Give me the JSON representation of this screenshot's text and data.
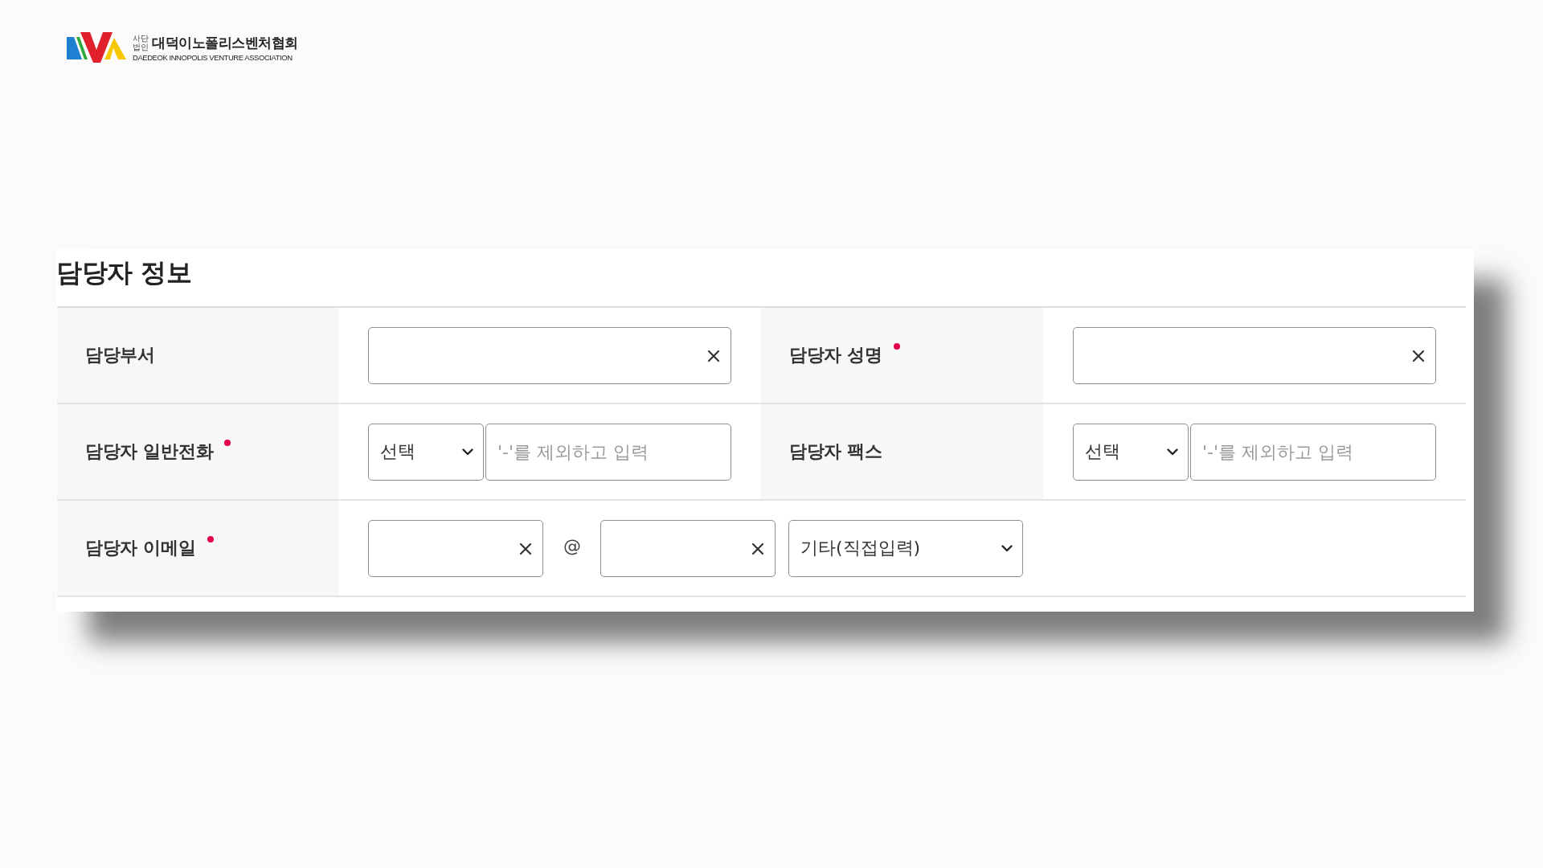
{
  "logo": {
    "prefix_lines": [
      "사단",
      "법인"
    ],
    "name": "대덕이노폴리스벤처협회",
    "english_name": "DAEDEOK INNOPOLIS VENTURE ASSOCIATION"
  },
  "section": {
    "title": "담당자 정보",
    "rows": [
      {
        "cells": [
          {
            "label": "담당부서",
            "required": false,
            "controls": [
              {
                "kind": "input",
                "clear": true
              }
            ]
          },
          {
            "label": "담당자 성명",
            "required": true,
            "controls": [
              {
                "kind": "input",
                "clear": true
              }
            ]
          }
        ]
      },
      {
        "cells": [
          {
            "label": "담당자 일반전화",
            "required": true,
            "controls": [
              {
                "kind": "select",
                "value": "선택"
              },
              {
                "kind": "input",
                "clear": false,
                "placeholder": "'-'를 제외하고 입력"
              }
            ]
          },
          {
            "label": "담당자 팩스",
            "required": false,
            "controls": [
              {
                "kind": "select",
                "value": "선택"
              },
              {
                "kind": "input",
                "clear": false,
                "placeholder": "'-'를 제외하고 입력"
              }
            ]
          }
        ]
      },
      {
        "cells": [
          {
            "label": "담당자 이메일",
            "required": true,
            "controls": [
              {
                "kind": "input",
                "clear": true
              },
              {
                "kind": "separator",
                "text": "@"
              },
              {
                "kind": "input",
                "clear": true
              },
              {
                "kind": "select",
                "value": "기타(직접입력)"
              }
            ]
          }
        ]
      }
    ]
  }
}
